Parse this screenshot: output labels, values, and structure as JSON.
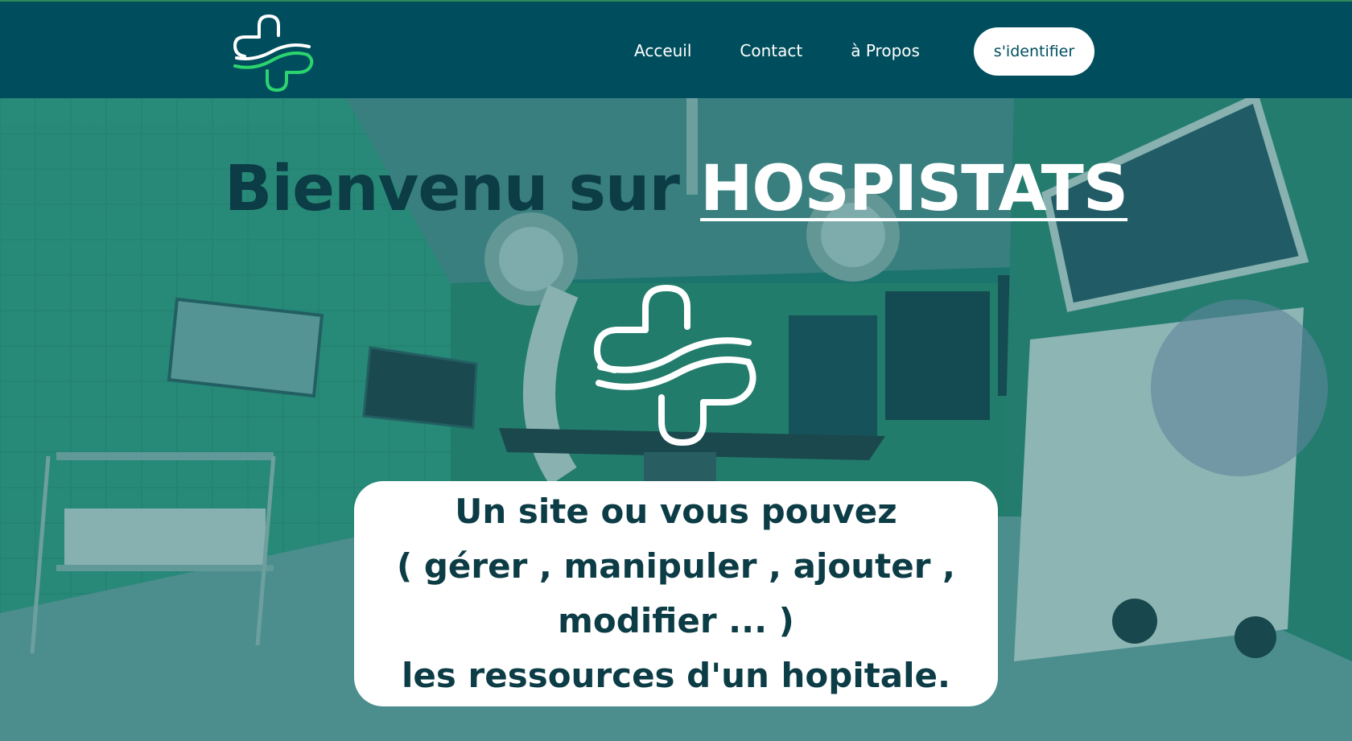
{
  "nav": {
    "logo_icon": "medical-cross-wave-icon",
    "links": [
      {
        "label": "Acceuil"
      },
      {
        "label": "Contact"
      },
      {
        "label": "à Propos"
      }
    ],
    "login_label": "s'identifier"
  },
  "hero": {
    "title_prefix": "Bienvenu sur ",
    "title_brand": "HOSPISTATS",
    "logo_icon": "medical-cross-wave-icon",
    "background": "operating-room-photo",
    "tagline": [
      "Un site ou vous pouvez",
      "( gérer , manipuler , ajouter ,",
      "modifier ... )",
      "les ressources d'un hopitale."
    ]
  },
  "colors": {
    "navbar": "#004e5d",
    "title_dark": "#0c3c45",
    "logo_green": "#2bd46e",
    "white": "#ffffff"
  }
}
